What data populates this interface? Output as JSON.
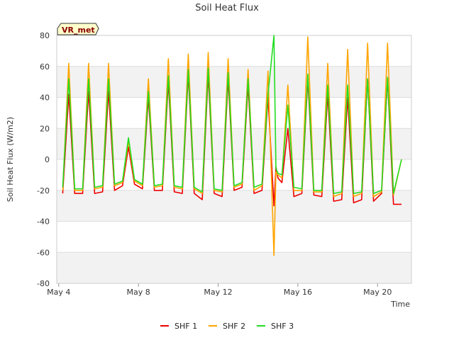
{
  "chart_data": {
    "type": "line",
    "title": "Soil Heat Flux",
    "xlabel": "Time",
    "ylabel": "Soil Heat Flux (W/m2)",
    "badge": "VR_met",
    "ylim": [
      -80,
      80
    ],
    "yticks": [
      -80,
      -60,
      -40,
      -20,
      0,
      20,
      40,
      60,
      80
    ],
    "xlim_days": [
      3.9,
      21.7
    ],
    "xticks": [
      {
        "day": 4,
        "label": "May 4"
      },
      {
        "day": 8,
        "label": "May 8"
      },
      {
        "day": 12,
        "label": "May 12"
      },
      {
        "day": 16,
        "label": "May 16"
      },
      {
        "day": 20,
        "label": "May 20"
      }
    ],
    "grid": true,
    "legend_position": "bottom",
    "colors": {
      "SHF 1": "#ee0000",
      "SHF 2": "#ffa500",
      "SHF 3": "#22dd22"
    },
    "series": [
      {
        "name": "SHF 1",
        "x": [
          4.2,
          4.5,
          4.8,
          5.2,
          5.5,
          5.8,
          6.2,
          6.5,
          6.8,
          7.2,
          7.5,
          7.8,
          8.2,
          8.5,
          8.8,
          9.2,
          9.5,
          9.8,
          10.2,
          10.5,
          10.8,
          11.2,
          11.5,
          11.8,
          12.2,
          12.5,
          12.8,
          13.2,
          13.5,
          13.8,
          14.2,
          14.5,
          14.8,
          14.9,
          15.0,
          15.2,
          15.5,
          15.8,
          16.2,
          16.5,
          16.8,
          17.2,
          17.5,
          17.8,
          18.2,
          18.5,
          18.8,
          19.2,
          19.5,
          19.8,
          20.2,
          20.5,
          20.8,
          21.2,
          21.5,
          21.8
        ],
        "y": [
          -22,
          42,
          -22,
          -22,
          44,
          -22,
          -21,
          44,
          -20,
          -17,
          8,
          -16,
          -19,
          40,
          -20,
          -20,
          50,
          -21,
          -22,
          55,
          -22,
          -26,
          55,
          -22,
          -24,
          52,
          -20,
          -18,
          48,
          -22,
          -20,
          40,
          -30,
          -5,
          -12,
          -15,
          20,
          -24,
          -22,
          52,
          -23,
          -24,
          42,
          -27,
          -26,
          40,
          -28,
          -26,
          52,
          -27,
          -22,
          52,
          -29,
          -29,
          0,
          0
        ]
      },
      {
        "name": "SHF 2",
        "x": [
          4.2,
          4.5,
          4.8,
          5.2,
          5.5,
          5.8,
          6.2,
          6.5,
          6.8,
          7.2,
          7.5,
          7.8,
          8.2,
          8.5,
          8.8,
          9.2,
          9.5,
          9.8,
          10.2,
          10.5,
          10.8,
          11.2,
          11.5,
          11.8,
          12.2,
          12.5,
          12.8,
          13.2,
          13.5,
          13.8,
          14.2,
          14.5,
          14.8,
          14.9,
          15.0,
          15.2,
          15.5,
          15.8,
          16.2,
          16.5,
          16.8,
          17.2,
          17.5,
          17.8,
          18.2,
          18.5,
          18.8,
          19.2,
          19.5,
          19.8,
          20.2,
          20.5,
          20.8,
          21.2,
          21.5,
          21.8
        ],
        "y": [
          -20,
          62,
          -20,
          -20,
          62,
          -19,
          -18,
          62,
          -17,
          -15,
          12,
          -14,
          -17,
          52,
          -18,
          -17,
          65,
          -18,
          -19,
          68,
          -19,
          -22,
          69,
          -20,
          -21,
          65,
          -18,
          -16,
          58,
          -20,
          -17,
          57,
          -62,
          -8,
          -10,
          -12,
          48,
          -20,
          -20,
          79,
          -21,
          -21,
          62,
          -24,
          -22,
          71,
          -24,
          -22,
          75,
          -24,
          -21,
          75,
          -23,
          0,
          0,
          0
        ]
      },
      {
        "name": "SHF 3",
        "x": [
          4.2,
          4.5,
          4.8,
          5.2,
          5.5,
          5.8,
          6.2,
          6.5,
          6.8,
          7.2,
          7.5,
          7.8,
          8.2,
          8.5,
          8.8,
          9.2,
          9.5,
          9.8,
          10.2,
          10.5,
          10.8,
          11.2,
          11.5,
          11.8,
          12.2,
          12.5,
          12.8,
          13.2,
          13.5,
          13.8,
          14.2,
          14.5,
          14.8,
          14.9,
          15.0,
          15.2,
          15.5,
          15.8,
          16.2,
          16.5,
          16.8,
          17.2,
          17.5,
          17.8,
          18.2,
          18.5,
          18.8,
          19.2,
          19.5,
          19.8,
          20.2,
          20.5,
          20.8,
          21.2,
          21.5,
          21.8
        ],
        "y": [
          -18,
          52,
          -19,
          -19,
          52,
          -18,
          -17,
          52,
          -16,
          -14,
          14,
          -13,
          -16,
          44,
          -17,
          -16,
          54,
          -17,
          -18,
          58,
          -18,
          -21,
          59,
          -19,
          -20,
          56,
          -17,
          -15,
          52,
          -18,
          -16,
          42,
          80,
          -6,
          -9,
          -10,
          35,
          -18,
          -19,
          55,
          -20,
          -20,
          48,
          -22,
          -21,
          48,
          -22,
          -21,
          52,
          -22,
          -20,
          53,
          -22,
          0,
          0,
          0
        ]
      }
    ]
  }
}
